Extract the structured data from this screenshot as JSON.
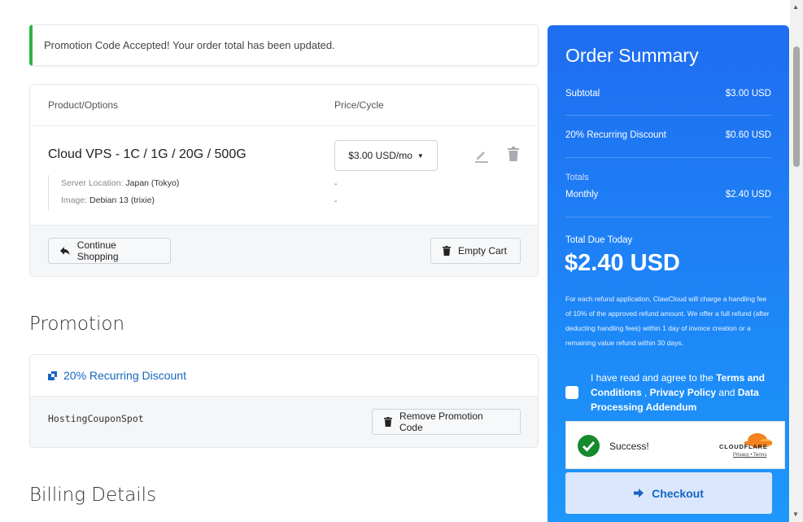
{
  "alert": {
    "message": "Promotion Code Accepted! Your order total has been updated."
  },
  "cart": {
    "col_product": "Product/Options",
    "col_price": "Price/Cycle",
    "product_name": "Cloud VPS - 1C / 1G / 20G / 500G",
    "options": [
      {
        "key": "Server Location:",
        "value": "Japan (Tokyo)",
        "price": "-"
      },
      {
        "key": "Image:",
        "value": "Debian 13 (trixie)",
        "price": "-"
      }
    ],
    "price_selected": "$3.00 USD/mo",
    "continue_label": "Continue Shopping",
    "empty_label": "Empty Cart"
  },
  "promotion": {
    "title": "Promotion",
    "discount_name": "20% Recurring Discount",
    "coupon_code": "HostingCouponSpot",
    "remove_label": "Remove Promotion Code"
  },
  "billing": {
    "title": "Billing Details"
  },
  "summary": {
    "title": "Order Summary",
    "subtotal_label": "Subtotal",
    "subtotal_value": "$3.00 USD",
    "discount_label": "20% Recurring Discount",
    "discount_value": "$0.60 USD",
    "totals_label": "Totals",
    "monthly_label": "Monthly",
    "monthly_value": "$2.40 USD",
    "due_label": "Total Due Today",
    "due_value": "$2.40 USD",
    "refund_note": "For each refund application, ClawCloud will charge a handling fee of 10% of the approved refund amount. We offer a full refund (after deducting handling fees) within 1 day of invoice creation or a remaining value refund within 30 days.",
    "agree_prefix": "I have read and agree to the ",
    "agree_terms": "Terms and Conditions",
    "agree_sep": " , ",
    "agree_privacy": "Privacy Policy",
    "agree_and": " and ",
    "agree_dpa": "Data Processing Addendum",
    "captcha_status": "Success!",
    "captcha_brand": "CLOUDFLARE",
    "captcha_links": "Privacy • Terms",
    "checkout_label": "Checkout"
  },
  "colors": {
    "accent": "#1f6df0",
    "success": "#2fb344",
    "link": "#1565c0"
  }
}
